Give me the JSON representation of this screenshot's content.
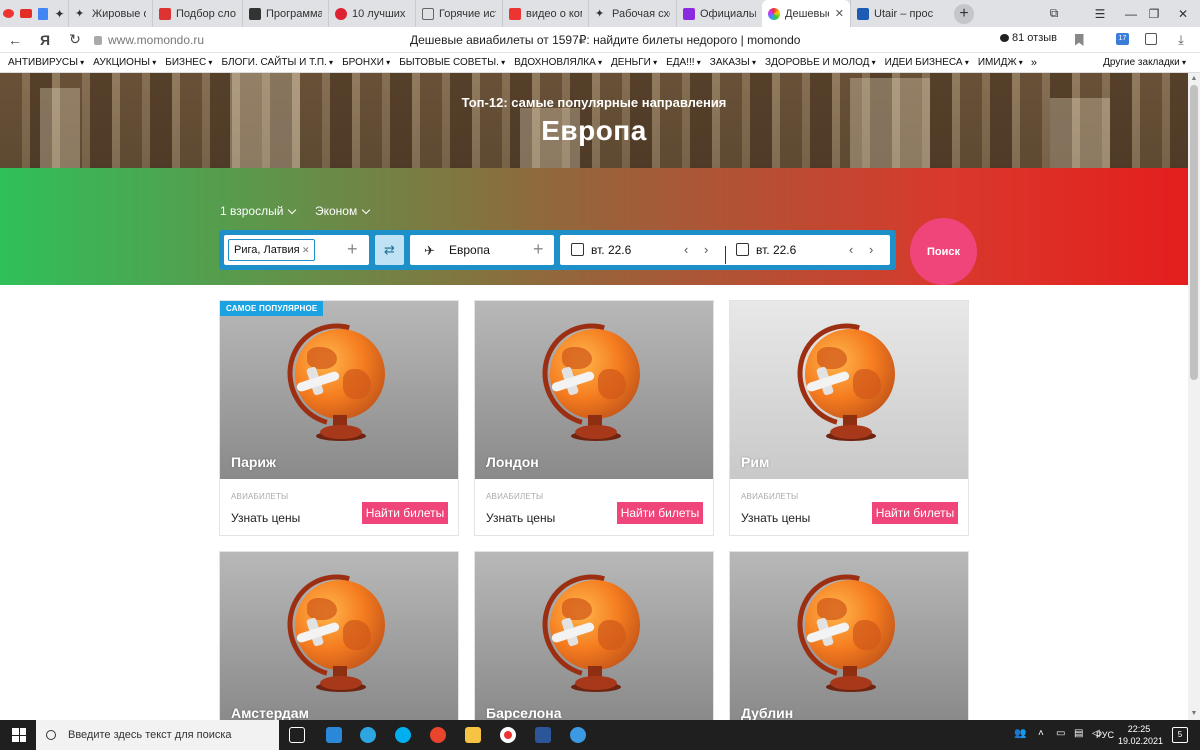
{
  "browser": {
    "tabs": [
      {
        "label": "Жировые от",
        "color": "#444"
      },
      {
        "label": "Подбор сло",
        "color": "#d33"
      },
      {
        "label": "Программа",
        "color": "#333"
      },
      {
        "label": "10 лучших п",
        "color": "#d23"
      },
      {
        "label": "Горячие ист",
        "color": "#666"
      },
      {
        "label": "видео о ком",
        "color": "#e33"
      },
      {
        "label": "Рабочая схе",
        "color": "#333"
      },
      {
        "label": "Официальн",
        "color": "#8a2be2"
      }
    ],
    "active_tab": {
      "label": "Дешевые"
    },
    "after_tab": {
      "label": "Utair – прос"
    },
    "url": "www.momondo.ru",
    "page_title": "Дешевые авиабилеты от 1597₽: найдите билеты недорого | momondo",
    "reviews": "81 отзыв",
    "yandex_letter": "Я",
    "ext_badge": "17"
  },
  "bookmarks": [
    "АНТИВИРУСЫ",
    "АУКЦИОНЫ",
    "БИЗНЕС",
    "БЛОГИ. САЙТЫ И Т.П.",
    "БРОНХИ",
    "БЫТОВЫЕ СОВЕТЫ.",
    "ВДОХНОВЛЯЛКА",
    "ДЕНЬГИ",
    "ЕДА!!!",
    "ЗАКАЗЫ",
    "ЗДОРОВЬЕ И МОЛОД",
    "ИДЕИ БИЗНЕСА",
    "ИМИДЖ"
  ],
  "bookmarks_more": "»",
  "bookmarks_other": "Другие закладки",
  "hero": {
    "subtitle": "Топ-12: самые популярные направления",
    "title": "Европа"
  },
  "search": {
    "passengers": "1 взрослый",
    "cabin": "Эконом",
    "origin": "Рига, Латвия",
    "destination": "Европа",
    "depart_date": "вт. 22.6",
    "return_date": "вт. 22.6",
    "button": "Поиск"
  },
  "cards": [
    {
      "city": "Париж",
      "badge": "САМОЕ ПОПУЛЯРНОЕ",
      "kicker": "АВИАБИЛЕТЫ",
      "learn": "Узнать цены",
      "button": "Найти билеты"
    },
    {
      "city": "Лондон",
      "badge": "",
      "kicker": "АВИАБИЛЕТЫ",
      "learn": "Узнать цены",
      "button": "Найти билеты"
    },
    {
      "city": "Рим",
      "badge": "",
      "kicker": "АВИАБИЛЕТЫ",
      "learn": "Узнать цены",
      "button": "Найти билеты"
    },
    {
      "city": "Амстердам"
    },
    {
      "city": "Барселона"
    },
    {
      "city": "Дублин"
    }
  ],
  "taskbar": {
    "search_placeholder": "Введите здесь текст для поиска",
    "lang": "РУС",
    "time": "22:25",
    "date": "19.02.2021",
    "notifications": "5"
  },
  "colors": {
    "accent_pink": "#f0457a",
    "accent_blue": "#1e90c9"
  }
}
